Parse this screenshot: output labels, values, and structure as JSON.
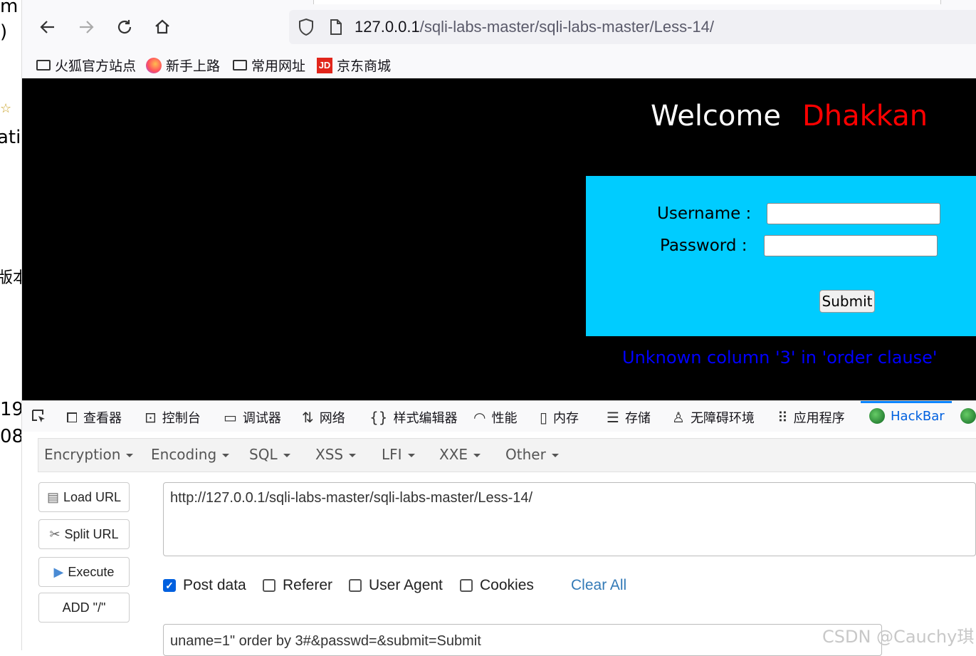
{
  "left_window_fragments": [
    "m",
    ")",
    "☆",
    "ati",
    "版本",
    "19",
    "08"
  ],
  "browser": {
    "url_host": "127.0.0.1",
    "url_path": "/sqli-labs-master/sqli-labs-master/Less-14/",
    "back_icon": "arrow-left-icon",
    "forward_icon": "arrow-right-icon",
    "reload_icon": "reload-icon",
    "home_icon": "home-icon"
  },
  "bookmarks": [
    {
      "label": "火狐官方站点",
      "icon": "folder-icon"
    },
    {
      "label": "新手上路",
      "icon": "firefox-icon"
    },
    {
      "label": "常用网址",
      "icon": "folder-icon"
    },
    {
      "label": "京东商城",
      "icon": "jd-icon"
    }
  ],
  "page": {
    "welcome": "Welcome",
    "user_name": "Dhakkan",
    "username_label": "Username :",
    "password_label": "Password :",
    "username_value": "",
    "password_value": "",
    "submit_label": "Submit",
    "error_message": "Unknown column '3' in 'order clause'",
    "colors": {
      "login_box": "#00ccff",
      "error": "#0000ff",
      "name": "#ff0000"
    }
  },
  "devtools": {
    "tabs": [
      "查看器",
      "控制台",
      "调试器",
      "网络",
      "样式编辑器",
      "性能",
      "内存",
      "存储",
      "无障碍环境",
      "应用程序",
      "HackBar"
    ],
    "active_tab": "HackBar"
  },
  "hackbar": {
    "menu": [
      "Encryption",
      "Encoding",
      "SQL",
      "XSS",
      "LFI",
      "XXE",
      "Other"
    ],
    "buttons": [
      "Load URL",
      "Split URL",
      "Execute",
      "ADD \"/\""
    ],
    "url_value": "http://127.0.0.1/sqli-labs-master/sqli-labs-master/Less-14/",
    "options": [
      {
        "label": "Post data",
        "checked": true
      },
      {
        "label": "Referer",
        "checked": false
      },
      {
        "label": "User Agent",
        "checked": false
      },
      {
        "label": "Cookies",
        "checked": false
      }
    ],
    "clear_all": "Clear All",
    "post_value": "uname=1\" order by 3#&passwd=&submit=Submit"
  },
  "watermark": "CSDN @Cauchy琪"
}
